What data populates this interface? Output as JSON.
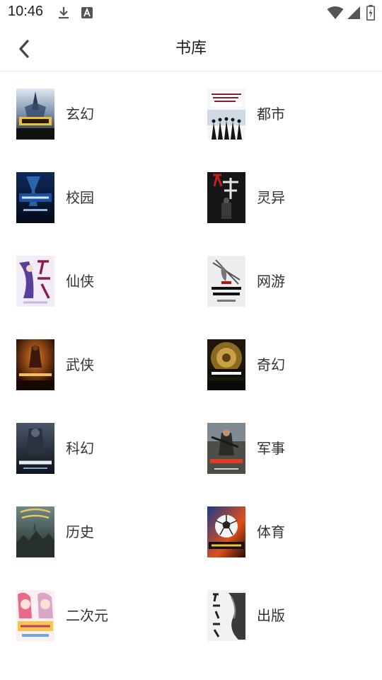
{
  "status_bar": {
    "time": "10:46",
    "icons": [
      "download-icon",
      "a-notification-icon",
      "wifi-icon",
      "signal-icon",
      "battery-charging-icon"
    ]
  },
  "header": {
    "title": "书库",
    "back_icon": "chevron-left-icon"
  },
  "categories": [
    {
      "label": "玄幻",
      "cover_icon": "book-cover-image"
    },
    {
      "label": "都市",
      "cover_icon": "book-cover-image"
    },
    {
      "label": "校园",
      "cover_icon": "book-cover-image"
    },
    {
      "label": "灵异",
      "cover_icon": "book-cover-image"
    },
    {
      "label": "仙侠",
      "cover_icon": "book-cover-image"
    },
    {
      "label": "网游",
      "cover_icon": "book-cover-image"
    },
    {
      "label": "武侠",
      "cover_icon": "book-cover-image"
    },
    {
      "label": "奇幻",
      "cover_icon": "book-cover-image"
    },
    {
      "label": "科幻",
      "cover_icon": "book-cover-image"
    },
    {
      "label": "军事",
      "cover_icon": "book-cover-image"
    },
    {
      "label": "历史",
      "cover_icon": "book-cover-image"
    },
    {
      "label": "体育",
      "cover_icon": "book-cover-image"
    },
    {
      "label": "二次元",
      "cover_icon": "book-cover-image"
    },
    {
      "label": "出版",
      "cover_icon": "book-cover-image"
    }
  ],
  "colors": {
    "text_primary": "#1a1a1a",
    "text_label": "#333333",
    "divider": "#eeeeee",
    "background": "#ffffff"
  }
}
